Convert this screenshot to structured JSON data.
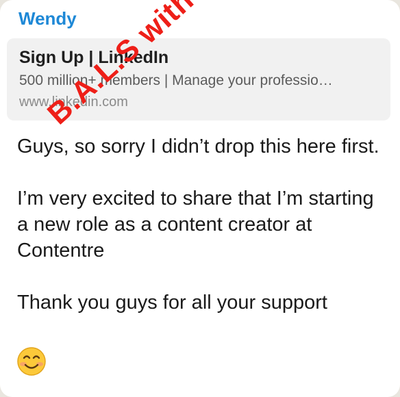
{
  "chat": {
    "sender": "Wendy",
    "link_preview": {
      "title": "Sign Up | LinkedIn",
      "description": "500 million+ members | Manage your professio…",
      "url": "www.linkedin.com"
    },
    "message": {
      "line1": "Guys, so sorry I didn’t drop this here first.",
      "line2": "I’m very excited to share that I’m starting a new role as a content creator at Contentre",
      "line3": "Thank you guys for all your support"
    },
    "emoji_icon": "smiling-face-emoji-icon"
  },
  "watermark": {
    "text": "B.A.L.S with Favour Lucy",
    "color": "#ee1f18"
  },
  "colors": {
    "sender_name": "#1e88d6",
    "bubble": "#ffffff",
    "preview_bg": "#f1f1f1"
  }
}
